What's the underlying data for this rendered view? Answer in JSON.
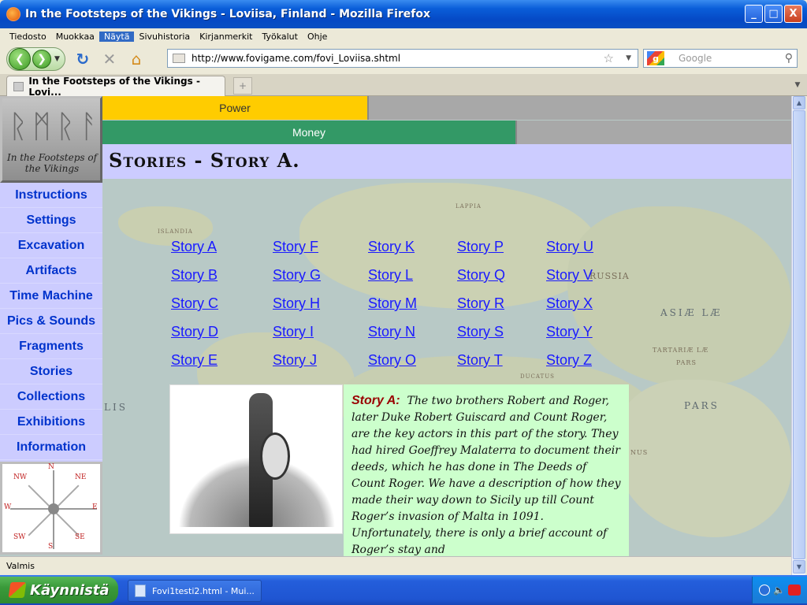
{
  "window": {
    "title": "In the Footsteps of the Vikings - Loviisa, Finland - Mozilla Firefox",
    "buttons": {
      "minimize": "_",
      "maximize": "□",
      "close": "X"
    }
  },
  "menubar": [
    "Tiedosto",
    "Muokkaa",
    "Näytä",
    "Sivuhistoria",
    "Kirjanmerkit",
    "Työkalut",
    "Ohje"
  ],
  "navbar": {
    "url": "http://www.fovigame.com/fovi_Loviisa.shtml",
    "search_placeholder": "Google"
  },
  "tab": {
    "title": "In the Footsteps of the Vikings - Lovi..."
  },
  "logo": {
    "text": "In the Footsteps of the Vikings"
  },
  "sidebar": {
    "items": [
      "Instructions",
      "Settings",
      "Excavation",
      "Artifacts",
      "Time Machine",
      "Pics & Sounds",
      "Fragments",
      "Stories",
      "Collections",
      "Exhibitions",
      "Information"
    ]
  },
  "compass": {
    "n": "N",
    "ne": "NE",
    "e": "E",
    "se": "SE",
    "s": "S",
    "sw": "SW",
    "w": "W",
    "nw": "NW"
  },
  "bars": {
    "power": "Power",
    "money": "Money"
  },
  "heading": "Stories -  Story A.",
  "stories": {
    "col1": [
      "Story A",
      "Story B",
      "Story C",
      "Story D",
      "Story E"
    ],
    "col2": [
      "Story F",
      "Story G",
      "Story H",
      "Story I",
      "Story J"
    ],
    "col3": [
      "Story K",
      "Story L",
      "Story M",
      "Story N",
      "Story O"
    ],
    "col4": [
      "Story P",
      "Story Q",
      "Story R",
      "Story S",
      "Story T"
    ],
    "col5": [
      "Story U",
      "Story V",
      "Story X",
      "Story Y",
      "Story Z"
    ]
  },
  "map_labels": {
    "asiae": "ASIÆ LÆ",
    "tartaria": "TARTARIÆ LÆ",
    "pars1": "PARS",
    "pars2": "PARS",
    "russia": "RUSSIA",
    "islandia": "ISLANDIA",
    "lapp": "LAPPIA",
    "ducatus": "DUCATUS",
    "lis": "LIS",
    "nus": "NUS"
  },
  "story": {
    "label": "Story A:",
    "text": "The two brothers Robert and Roger, later Duke  Robert  Guiscard and Count Roger, are the key actors in this part of the story. They had hired Goeffrey  Malaterra to document their deeds,  which he has done in The Deeds of Count Roger. We have a description of how  they made their way down  to Sicily up till Count Roger’s invasion of  Malta in 1091. Unfortunately, there is only a brief account of Roger’s stay and"
  },
  "status": "Valmis",
  "taskbar": {
    "start": "Käynnistä",
    "task": "Fovi1testi2.html - Mui..."
  }
}
